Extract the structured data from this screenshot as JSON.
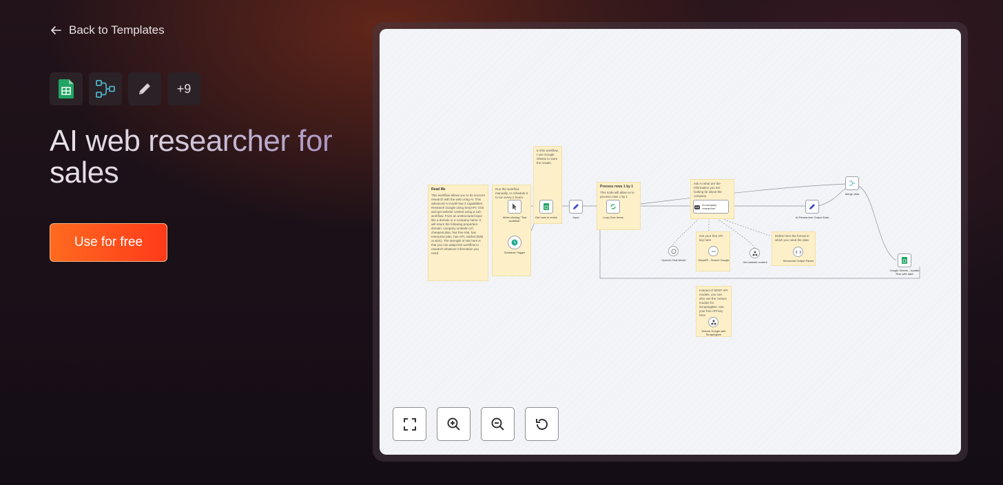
{
  "nav": {
    "back_label": "Back to Templates"
  },
  "integrations": {
    "items": [
      "google-sheets-icon",
      "merge-flow-icon",
      "edit-pencil-icon"
    ],
    "more_label": "+9"
  },
  "hero": {
    "title": "AI web researcher for sales"
  },
  "cta": {
    "label": "Use for free"
  },
  "colors": {
    "accent": "#ff4f1c",
    "sheets_green": "#21a464",
    "flow_teal": "#4fb3c7"
  },
  "workflow": {
    "notes": {
      "readme_title": "Read Me",
      "readme_body": "This workflow allows you to do account research with the web using AI. This advanced AI model has 2 capabilities: Research Google using SerpAPI; Visit and get website content using a sub-workflow. From an unstructured input like a domain or a company name. It will return the following properties: domain, company LinkedIn Url, cheapest plan, has free trial, has enterprise plan, has API, market (B2B or B2C). The strength of n8n here is that you can adapt this workflow to research whatever information you need.",
      "run_note": "Run the workflow manually, or schedule it to run every 2 hours.",
      "sheet_note": "In this workflow, I use Google Sheets to store the results.",
      "loop_title": "Process rows 1 by 1",
      "loop_body": "This node will allow us to process rows 1 by 1",
      "agent_note": "Ask AI what are the information you are looking for about the company",
      "serp_note": "Get your free API key here",
      "parser_note": "Define here the format in which you need the data",
      "subflow_note": "Instead of SERP API module, you can also use the custom module for ScrapingBee. Get your free API key here"
    },
    "nodes": {
      "manual_trigger": "When clicking \"Test workflow\"",
      "schedule_trigger": "Schedule Trigger",
      "get_rows": "Get rows to enrich",
      "input": "Input",
      "loop": "Loop Over Items",
      "agent": "AI company researcher",
      "rename": "AI Researcher Output Data",
      "merge": "Merge data",
      "update": "Google Sheets - Update Row with data",
      "openai": "OpenAI Chat Model",
      "serpapi": "SerpAPI - Search Google",
      "get_website": "Get website content",
      "parser": "Structured Output Parser",
      "search_tool": "Search Google with Scrapingbee"
    }
  },
  "controls": [
    "fullscreen-icon",
    "zoom-in-icon",
    "zoom-out-icon",
    "reset-icon"
  ]
}
